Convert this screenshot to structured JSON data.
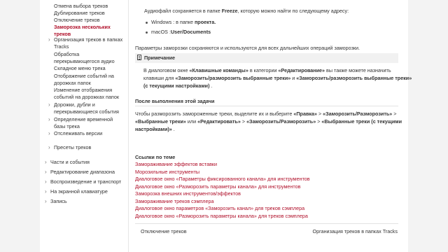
{
  "sidebar": {
    "items": [
      {
        "label": "Отмена выбора треков",
        "level": "sub",
        "active": false,
        "chevron": false
      },
      {
        "label": "Дублирование треков",
        "level": "sub",
        "active": false,
        "chevron": false
      },
      {
        "label": "Отключение треков",
        "level": "sub",
        "active": false,
        "chevron": false
      },
      {
        "label": "Заморозка нескольких треков",
        "level": "sub",
        "active": true,
        "chevron": false
      },
      {
        "label": "Организация треков в папках Tracks",
        "level": "sub",
        "active": false,
        "chevron": true
      },
      {
        "label": "Обработка перекрывающегося аудио",
        "level": "sub",
        "active": false,
        "chevron": false
      },
      {
        "label": "Складное меню трека",
        "level": "sub",
        "active": false,
        "chevron": false
      },
      {
        "label": "Отображение событий на дорожках папок",
        "level": "sub",
        "active": false,
        "chevron": false
      },
      {
        "label": "Изменение отображения событий на дорожках папок",
        "level": "sub",
        "active": false,
        "chevron": false
      },
      {
        "label": "Дорожки, дубли и перекрывающиеся события",
        "level": "sub",
        "active": false,
        "chevron": true
      },
      {
        "label": "Определение временной базы трека",
        "level": "sub",
        "active": false,
        "chevron": true
      },
      {
        "label": "Отслеживать версии",
        "level": "sub",
        "active": false,
        "chevron": true
      },
      {
        "label": "Пресеты треков",
        "level": "sub",
        "active": false,
        "chevron": true
      },
      {
        "label": "Части и события",
        "level": "top",
        "active": false,
        "chevron": true
      },
      {
        "label": "Редактирование диапазона",
        "level": "top",
        "active": false,
        "chevron": true
      },
      {
        "label": "Воспроизведение и транспорт",
        "level": "top",
        "active": false,
        "chevron": true
      },
      {
        "label": "На экранной клавиатуре",
        "level": "top",
        "active": false,
        "chevron": true
      },
      {
        "label": "Запись",
        "level": "top",
        "active": false,
        "chevron": true
      }
    ]
  },
  "content": {
    "intro_a": "Аудиофайл сохраняется в папке ",
    "intro_b": "Freeze",
    "intro_c": ", которую можно найти по следующему адресу:",
    "windows_a": "Windows : в папке ",
    "windows_b": "проекта.",
    "mac_a": "macOS :",
    "mac_b": "User/Documents",
    "params": "Параметры заморозки сохраняются и используются для всех дальнейших операций заморозки.",
    "note_title": "Примечание",
    "note_l1_a": "В диалоговом окне ",
    "note_l1_b": "«Клавишные команды»",
    "note_l1_c": " в категории ",
    "note_l1_d": "«Редактирование»",
    "note_l1_e": " вы также можете назначить",
    "note_l2_a": "клавиши для ",
    "note_l2_b": "«Заморозить/разморозить выбранные треки»",
    "note_l2_c": " и ",
    "note_l2_d": "«Заморозить/разморозить выбранные треки»",
    "note_l3_a": "(с текущими настройками)",
    "note_l3_b": " .",
    "after_title": "После выполнения этой задачи",
    "after_l1_a": "Чтобы разморозить замороженные треки, выделите их и выберите ",
    "after_l1_b": "«Правка»",
    "after_l1_c": " > ",
    "after_l1_d": "«Заморозить/Разморозить»",
    "after_l1_e": " > ",
    "after_l2_a": "«Выбранные треки»",
    "after_l2_b": " или ",
    "after_l2_c": "«Редактировать»",
    "after_l2_d": " > ",
    "after_l2_e": "«Заморозить/Разморозить»",
    "after_l2_f": " > ",
    "after_l2_g": "«Выбранные треки (с текущими",
    "after_l3_a": "настройками)»",
    "after_l3_b": " .",
    "related_title": "Ссылки по теме",
    "related": [
      "Замораживание эффектов вставки",
      "Морозильные инструменты",
      "Диалоговое окно «Параметры фиксированного канала» для инструментов",
      "Диалоговое окно «Разморозить параметры канала» для инструментов",
      "Заморозка внешних инструментов/эффектов",
      "Замораживание треков сэмплера",
      "Диалоговое окно параметров «Заморозить канал» для треков сэмплера",
      "Диалоговое окно «Разморозить параметры канала» для треков сэмплера"
    ],
    "prev_link": "Отключение треков",
    "next_link": "Организация треков в папках Tracks"
  }
}
